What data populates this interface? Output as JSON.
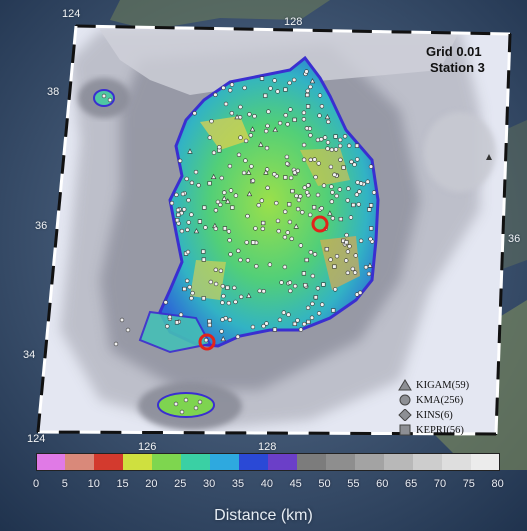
{
  "map": {
    "grid_label": "Grid 0.01",
    "station_label": "Station 3",
    "lon_ticks": [
      "124",
      "126",
      "128"
    ],
    "lon_ticks_top": [
      "124",
      "128"
    ],
    "lat_ticks": [
      "38",
      "36",
      "34"
    ],
    "lat_ticks_right": [
      "36"
    ],
    "highlighted_stations": 3
  },
  "legend": {
    "items": [
      {
        "label": "KIGAM(59)",
        "symbol": "triangle-icon"
      },
      {
        "label": "KMA(256)",
        "symbol": "circle-icon"
      },
      {
        "label": "KINS(6)",
        "symbol": "diamond-icon"
      },
      {
        "label": "KEPRI(56)",
        "symbol": "square-icon"
      }
    ]
  },
  "colorbar": {
    "title": "Distance (km)",
    "ticks": [
      "0",
      "5",
      "10",
      "15",
      "20",
      "25",
      "30",
      "35",
      "40",
      "45",
      "50",
      "55",
      "60",
      "65",
      "70",
      "75",
      "80"
    ],
    "colors": [
      "#e07ae6",
      "#d9897a",
      "#d33a2e",
      "#cfe03f",
      "#7ed64f",
      "#3ad0a4",
      "#2ea9df",
      "#2a49d6",
      "#6b3fc8",
      "#7c7c7c",
      "#8e8e8e",
      "#a3a3a3",
      "#b8b8b8",
      "#cdcdcd",
      "#dedede",
      "#ececec"
    ]
  }
}
